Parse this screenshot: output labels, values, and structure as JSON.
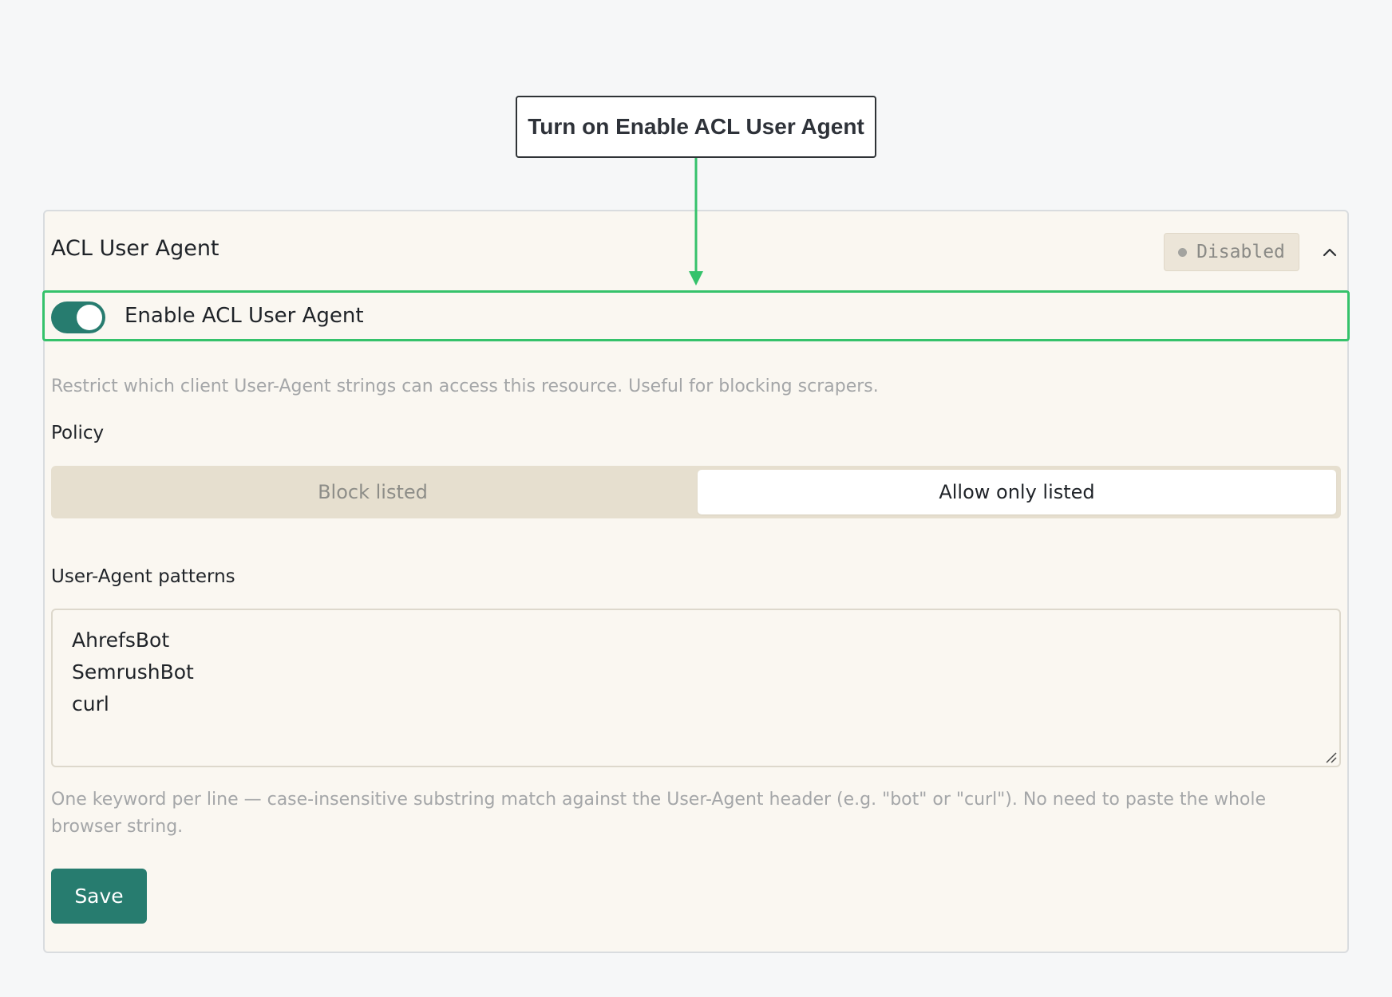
{
  "annotation": {
    "callout_text": "Turn on Enable ACL User Agent",
    "arrow_color": "#35c26b"
  },
  "panel": {
    "title": "ACL User Agent",
    "status_badge": "Disabled",
    "collapse_icon": "chevron-up-icon"
  },
  "toggle": {
    "label": "Enable ACL User Agent",
    "checked": true,
    "on_color": "#277c6f"
  },
  "description": "Restrict which client User-Agent strings can access this resource. Useful for blocking scrapers.",
  "policy": {
    "label": "Policy",
    "options": [
      "Block listed",
      "Allow only listed"
    ],
    "selected": "Allow only listed"
  },
  "patterns": {
    "label": "User-Agent patterns",
    "lines": [
      "AhrefsBot",
      "SemrushBot",
      "curl"
    ],
    "help": "One keyword per line — case-insensitive substring match against the User-Agent header (e.g. \"bot\" or \"curl\"). No need to paste the whole browser string."
  },
  "actions": {
    "save_label": "Save"
  },
  "colors": {
    "accent": "#277c6f",
    "highlight": "#35c26b",
    "panel_bg": "#faf7f1"
  }
}
